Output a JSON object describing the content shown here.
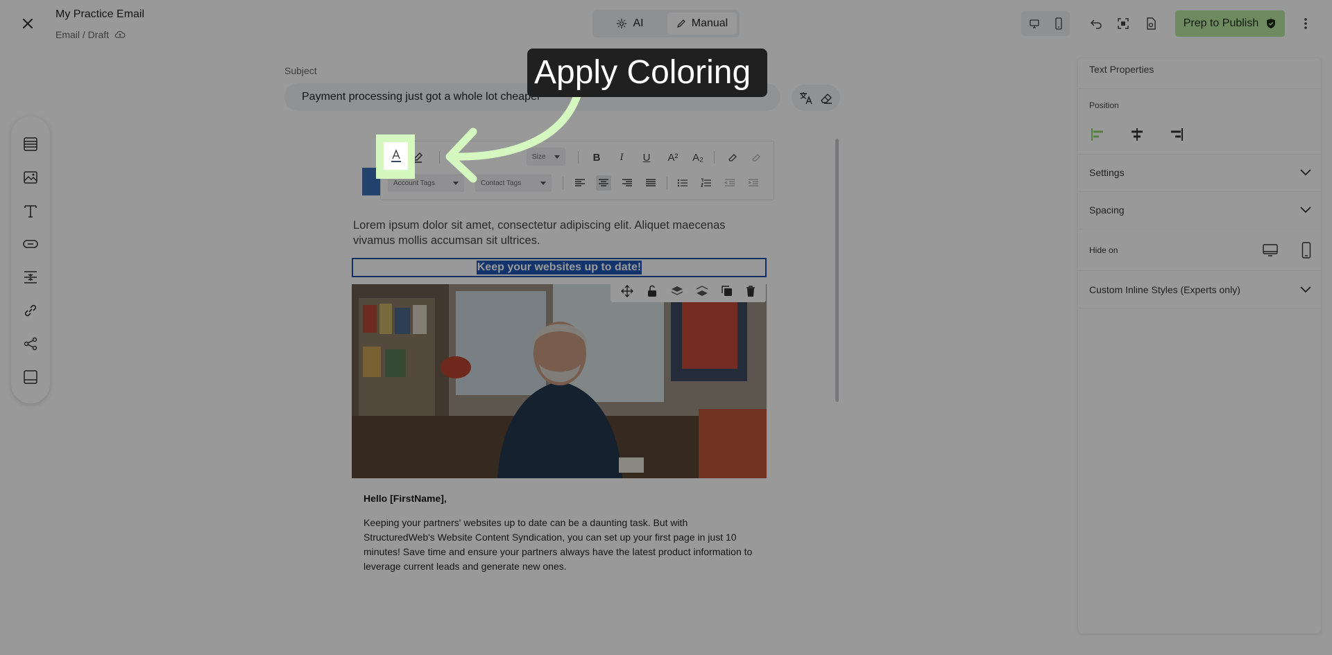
{
  "topbar": {
    "title": "My Practice Email",
    "subtitle": "Email / Draft",
    "modes": {
      "ai": "AI",
      "manual": "Manual"
    },
    "publish_label": "Prep to Publish"
  },
  "subject": {
    "label": "Subject",
    "value": "Payment processing just got a whole lot cheaper"
  },
  "editor_toolbar": {
    "size_placeholder": "Size",
    "account_tags": "Account Tags",
    "contact_tags": "Contact Tags",
    "superscript": "A²",
    "subscript": "A₂"
  },
  "email": {
    "lorem": "Lorem ipsum dolor sit amet, consectetur adipiscing elit. Aliquet maecenas vivamus mollis accumsan sit ultrices.",
    "headline": "Keep your websites up to date!",
    "greeting": "Hello [FirstName],",
    "paragraph": "Keeping your partners' websites up to date can be a daunting task. But with StructuredWeb's Website Content Syndication, you can set up your first page in just 10 minutes! Save time and ensure your partners always have the latest product information to leverage current leads and generate new ones."
  },
  "right_panel": {
    "title": "Text Properties",
    "position_label": "Position",
    "sections": {
      "settings": "Settings",
      "spacing": "Spacing",
      "hide_on": "Hide on",
      "custom_styles": "Custom Inline Styles (Experts only)"
    }
  },
  "callout": {
    "text": "Apply Coloring"
  },
  "colors": {
    "accent_green": "#b6e6a0",
    "highlight_green": "#d4f8c0",
    "selection_blue": "#1f56b3"
  }
}
